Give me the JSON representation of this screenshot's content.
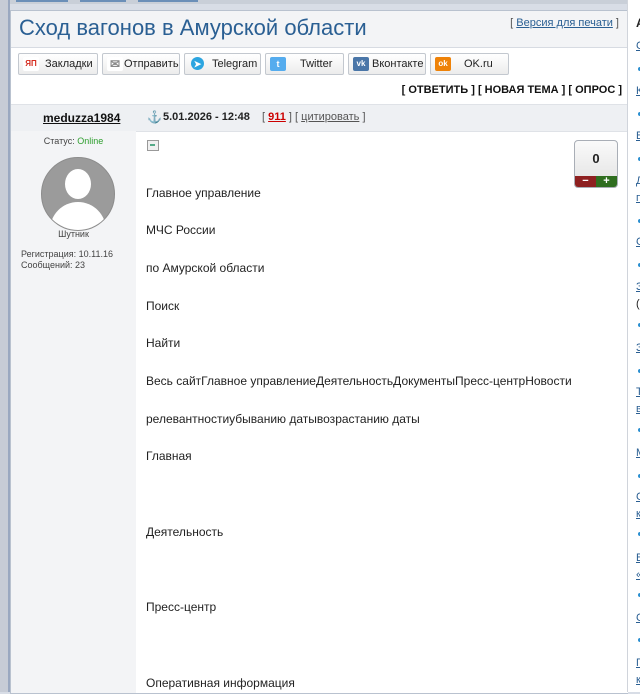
{
  "page": {
    "title": "Сход вагонов в Амурской области",
    "print_link": "Версия для печати"
  },
  "share_buttons": [
    {
      "label": "Закладки",
      "icon": "yandex-bookmarks-icon",
      "icon_text": "ЯП",
      "color": "#d52b1e"
    },
    {
      "label": "Отправить",
      "icon": "mail-icon",
      "icon_text": "✉",
      "color": "#8a8a8a"
    },
    {
      "label": "Telegram",
      "icon": "telegram-icon",
      "icon_text": "➤",
      "color": "#2ca5e0"
    },
    {
      "label": "Twitter",
      "icon": "twitter-icon",
      "icon_text": "t",
      "color": "#55acee"
    },
    {
      "label": "Вконтакте",
      "icon": "vk-icon",
      "icon_text": "vk",
      "color": "#4a76a8"
    },
    {
      "label": "OK.ru",
      "icon": "ok-icon",
      "icon_text": "ok",
      "color": "#ee8208"
    }
  ],
  "actions": {
    "text": "[ ОТВЕТИТЬ ] [ НОВАЯ ТЕМА ] [ ОПРОС ]"
  },
  "post": {
    "author": "meduzza1984",
    "date": "5.01.2026 - 12:48",
    "number": "911",
    "quote_label": "цитировать",
    "status_label": "Статус:",
    "status_value": "Online",
    "rank": "Шутник",
    "registration": "Регистрация: 10.11.16",
    "messages": "Сообщений: 23",
    "rating": "0",
    "lines": [
      "Главное управление",
      "МЧС России",
      "по Амурской области",
      "Поиск",
      "Найти",
      "Весь сайтГлавное управлениеДеятельностьДокументыПресс-центрНовости",
      "релевантностиубыванию датывозрастанию даты",
      "Главная",
      "Деятельность",
      "Пресс-центр",
      "Оперативная информация"
    ]
  },
  "colors": {
    "link": "#2a5f93",
    "online": "#2e9e2e",
    "post_number": "#cc0000"
  }
}
